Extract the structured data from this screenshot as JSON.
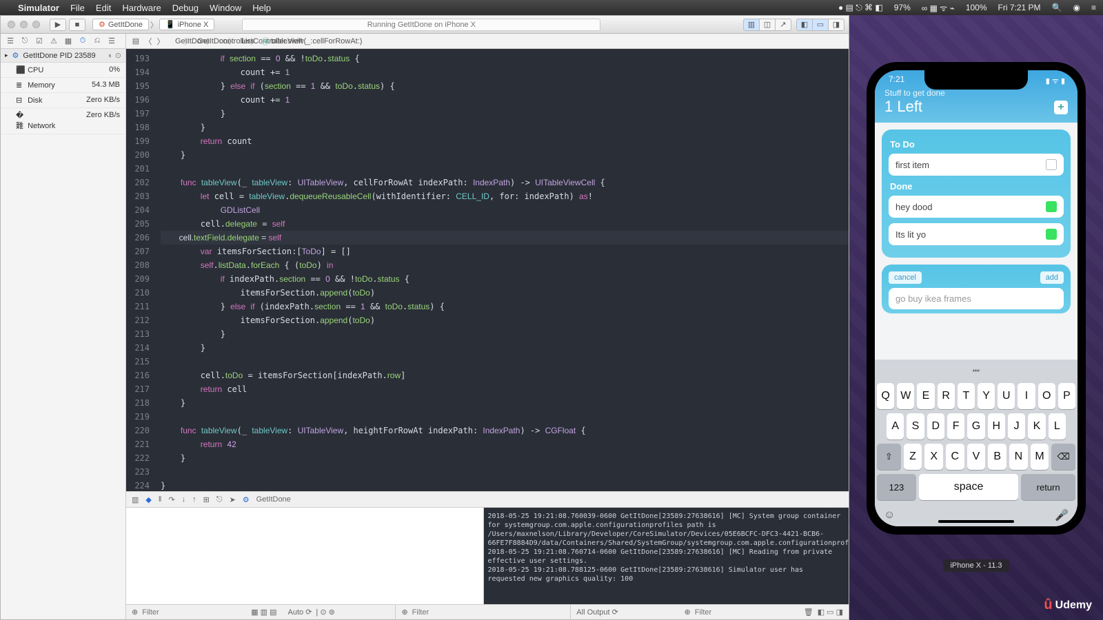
{
  "menubar": {
    "app": "Simulator",
    "items": [
      "File",
      "Edit",
      "Hardware",
      "Debug",
      "Window",
      "Help"
    ],
    "right": {
      "pct1": "97%",
      "icons": "∞ ▦ ᯤ ⌁",
      "pct2": "100%",
      "batt": "▣",
      "clock": "Fri 7:21 PM"
    }
  },
  "toolbar": {
    "scheme": "GetItDone",
    "device": "iPhone X",
    "status": "Running GetItDone on iPhone X"
  },
  "sidebar": {
    "process": "GetItDone PID 23589",
    "rows": [
      {
        "label": "CPU",
        "value": "0%"
      },
      {
        "label": "Memory",
        "value": "54.3 MB"
      },
      {
        "label": "Disk",
        "value": "Zero KB/s"
      },
      {
        "label": "Network",
        "value": "Zero KB/s"
      }
    ]
  },
  "jumpbar": {
    "crumbs": [
      "GetItDone",
      "GetItDone",
      "controllers",
      "ListController.swift",
      "tableView(_:cellForRowAt:)"
    ]
  },
  "code": {
    "start": 193,
    "lines": [
      "            if section == 0 && !toDo.status {",
      "                count += 1",
      "            } else if (section == 1 && toDo.status) {",
      "                count += 1",
      "            }",
      "        }",
      "        return count",
      "    }",
      "",
      "    func tableView(_ tableView: UITableView, cellForRowAt indexPath: IndexPath) -> UITableViewCell {",
      "        let cell = tableView.dequeueReusableCell(withIdentifier: CELL_ID, for: indexPath) as!",
      "            GDListCell",
      "        cell.delegate = self",
      "        cell.textField.delegate = self",
      "        var itemsForSection:[ToDo] = []",
      "        self.listData.forEach { (toDo) in",
      "            if indexPath.section == 0 && !toDo.status {",
      "                itemsForSection.append(toDo)",
      "            } else if (indexPath.section == 1 && toDo.status) {",
      "                itemsForSection.append(toDo)",
      "            }",
      "        }",
      "",
      "        cell.toDo = itemsForSection[indexPath.row]",
      "        return cell",
      "    }",
      "",
      "    func tableView(_ tableView: UITableView, heightForRowAt indexPath: IndexPath) -> CGFloat {",
      "        return 42",
      "    }",
      "",
      "}",
      ""
    ],
    "highlight_index": 13
  },
  "debugbar": {
    "target": "GetItDone"
  },
  "console": "2018-05-25 19:21:08.760039-0600 GetItDone[23589:27638616] [MC] System group container for systemgroup.com.apple.configurationprofiles path is /Users/maxnelson/Library/Developer/CoreSimulator/Devices/05E6BCFC-DFC3-4421-BCB6-66FE7F8884D9/data/Containers/Shared/SystemGroup/systemgroup.com.apple.configurationprofiles\n2018-05-25 19:21:08.760714-0600 GetItDone[23589:27638616] [MC] Reading from private effective user settings.\n2018-05-25 19:21:08.788125-0600 GetItDone[23589:27638616] Simulator user has requested new graphics quality: 100",
  "bottom": {
    "auto": "Auto ⟳",
    "alloutput": "All Output ⟳",
    "filter": "Filter"
  },
  "simulator": {
    "label": "iPhone X - 11.3",
    "status_time": "7:21",
    "header_sub": "Stuff to get done",
    "header_title": "1 Left",
    "sections": {
      "todo_label": "To Do",
      "done_label": "Done",
      "todo_items": [
        {
          "text": "first item",
          "done": false
        }
      ],
      "done_items": [
        {
          "text": "hey dood",
          "done": true
        },
        {
          "text": "Its lit yo",
          "done": true
        }
      ]
    },
    "add": {
      "cancel": "cancel",
      "add": "add",
      "placeholder": "go buy ikea frames"
    },
    "keyboard": {
      "suggestion": "\"\"",
      "row1": [
        "Q",
        "W",
        "E",
        "R",
        "T",
        "Y",
        "U",
        "I",
        "O",
        "P"
      ],
      "row2": [
        "A",
        "S",
        "D",
        "F",
        "G",
        "H",
        "J",
        "K",
        "L"
      ],
      "row3": [
        "⇧",
        "Z",
        "X",
        "C",
        "V",
        "B",
        "N",
        "M",
        "⌫"
      ],
      "row4": {
        "nums": "123",
        "space": "space",
        "return": "return"
      }
    }
  },
  "brand": "Udemy"
}
